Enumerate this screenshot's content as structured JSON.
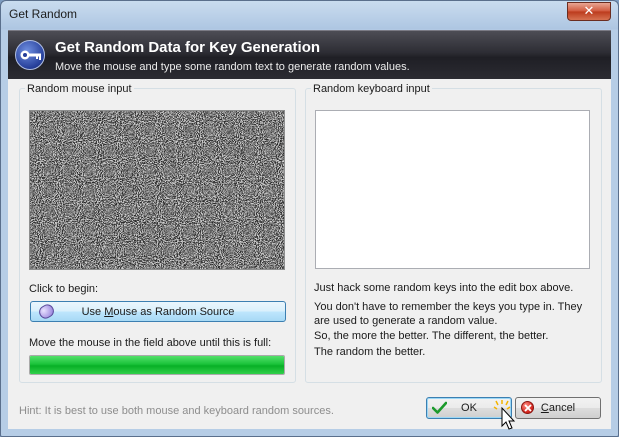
{
  "window": {
    "title": "Get Random",
    "close_glyph": "✕"
  },
  "header": {
    "icon": "key-icon",
    "title": "Get Random Data for Key Generation",
    "subtitle": "Move the mouse and type some random text to generate random values."
  },
  "mouse_group": {
    "label": "Random mouse input",
    "click_label": "Click to begin:",
    "button_label_pre": "Use ",
    "button_label_mnemonic": "M",
    "button_label_post": "ouse as Random Source",
    "button_icon": "mouse-icon",
    "progress_label": "Move the mouse in the field above until this is full:",
    "progress_fraction": 1.0
  },
  "keyboard_group": {
    "label": "Random keyboard input",
    "input_value": "",
    "text_1": "Just hack some random keys into the edit box above.",
    "text_2a": "You don't have to remember the keys you type in. They",
    "text_2b": "are used to generate a random value.",
    "text_3": "So, the more the better. The different, the better.",
    "text_4": "The random the better."
  },
  "footer": {
    "hint": "Hint: It is best to use both mouse and keyboard random sources.",
    "ok_label": "OK",
    "cancel_label_mnemonic": "C",
    "cancel_label_rest": "ancel"
  },
  "colors": {
    "progress_green": "#1bc33b",
    "header_dark": "#2d2d34",
    "close_red": "#c9462a"
  }
}
